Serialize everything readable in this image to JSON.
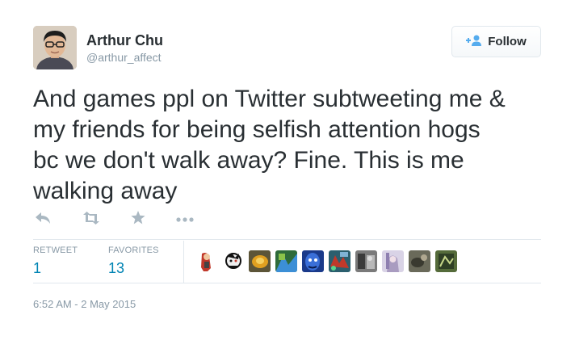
{
  "author": {
    "name": "Arthur Chu",
    "handle": "@arthur_affect"
  },
  "follow_button": {
    "label": "Follow",
    "icon": "add-user-icon"
  },
  "tweet": {
    "text_lines": [
      "And games ppl on Twitter subtweeting me &",
      "my friends for being selfish attention hogs",
      "bc we don't walk away? Fine. This is me",
      "walking away"
    ]
  },
  "actions": [
    {
      "name": "reply",
      "icon": "reply-icon"
    },
    {
      "name": "retweet",
      "icon": "retweet-icon"
    },
    {
      "name": "favorite",
      "icon": "star-icon"
    },
    {
      "name": "more",
      "icon": "more-icon"
    }
  ],
  "stats": {
    "retweets": {
      "label": "RETWEET",
      "value": "1"
    },
    "favorites": {
      "label": "FAVORITES",
      "value": "13"
    }
  },
  "favoriter_avatars_count": 10,
  "timestamp": "6:52 AM - 2 May 2015",
  "colors": {
    "text": "#292f33",
    "muted": "#8899a6",
    "link": "#0084b4",
    "follow_icon": "#55acee",
    "action_icon": "#aab8c2"
  }
}
